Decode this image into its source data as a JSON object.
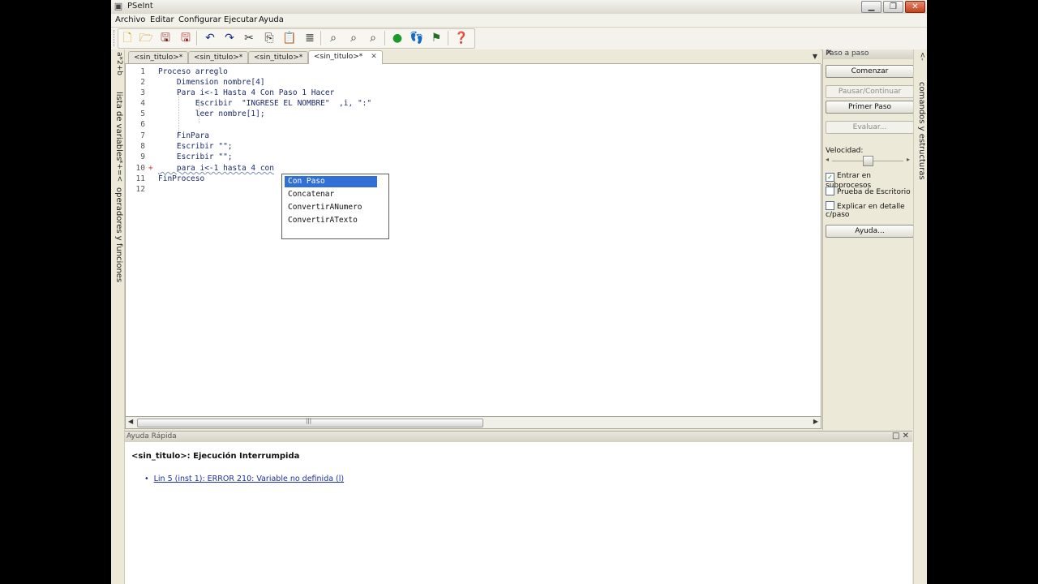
{
  "window": {
    "title": "PSeInt",
    "controls": {
      "minimize": "▁",
      "maximize": "❐",
      "close": "✕"
    }
  },
  "menu": [
    "Archivo",
    "Editar",
    "Configurar",
    "Ejecutar",
    "Ayuda"
  ],
  "toolbar": {
    "buttons": [
      "new-file",
      "open",
      "save",
      "save-as",
      "undo",
      "redo",
      "cut",
      "copy",
      "paste",
      "indent",
      "search",
      "find-prev",
      "find-next",
      "run",
      "step-by-step",
      "debug",
      "help"
    ]
  },
  "left_strip": {
    "tab_variables": "lista de variables",
    "tab_operators": "operadores y funciones",
    "symbols_variables": "a*2+b",
    "symbols_operators": "*+=<"
  },
  "tabs": [
    {
      "label": "<sin_titulo>*",
      "active": false
    },
    {
      "label": "<sin_titulo>*",
      "active": false
    },
    {
      "label": "<sin_titulo>*",
      "active": false
    },
    {
      "label": "<sin_titulo>*",
      "active": true,
      "close": "✕"
    }
  ],
  "tab_menu_icon": "▼",
  "code_lines": [
    {
      "n": "1",
      "text": "Proceso arreglo"
    },
    {
      "n": "2",
      "text": "    Dimension nombre[4]"
    },
    {
      "n": "3",
      "text": "    Para i<-1 Hasta 4 Con Paso 1 Hacer"
    },
    {
      "n": "4",
      "text": "        Escribir  \"INGRESE EL NOMBRE\"  ,i, \":\""
    },
    {
      "n": "5",
      "text": "        leer nombre[1];"
    },
    {
      "n": "6",
      "text": ""
    },
    {
      "n": "7",
      "text": "    FinPara"
    },
    {
      "n": "8",
      "text": "    Escribir \"\";"
    },
    {
      "n": "9",
      "text": "    Escribir \"\";"
    },
    {
      "n": "10",
      "text": "    para i<-1 hasta 4 con"
    },
    {
      "n": "11",
      "text": "FinProceso"
    },
    {
      "n": "12",
      "text": ""
    }
  ],
  "line10_marker": "+",
  "autocomplete": {
    "items": [
      "Con Paso",
      "Concatenar",
      "ConvertirANumero",
      "ConvertirATexto"
    ],
    "selected_index": 0
  },
  "scrollbar": {
    "left_arrow": "◀",
    "right_arrow": "▶",
    "grip": "|||"
  },
  "step_panel": {
    "title": "Paso a paso",
    "close": "✕",
    "buttons": {
      "comenzar": "Comenzar",
      "pausar": "Pausar/Continuar",
      "primer_paso": "Primer Paso",
      "evaluar": "Evaluar...",
      "ayuda": "Ayuda..."
    },
    "velocidad_label": "Velocidad:",
    "velocidad_level": 0.5,
    "checkboxes": [
      {
        "label": "Entrar en subprocesos",
        "checked": true
      },
      {
        "label": "Prueba de Escritorio",
        "checked": false
      },
      {
        "label": "Explicar en detalle c/paso",
        "checked": false
      }
    ]
  },
  "right_strip": {
    "tab_commands": "comandos y estructuras",
    "symbols": "<-"
  },
  "help_panel": {
    "title": "Ayuda Rápida",
    "controls": "□ ✕",
    "heading": "<sin_titulo>: Ejecución Interrumpida",
    "errors": [
      "Lin 5 (inst 1): ERROR 210: Variable no definida (l)"
    ]
  }
}
